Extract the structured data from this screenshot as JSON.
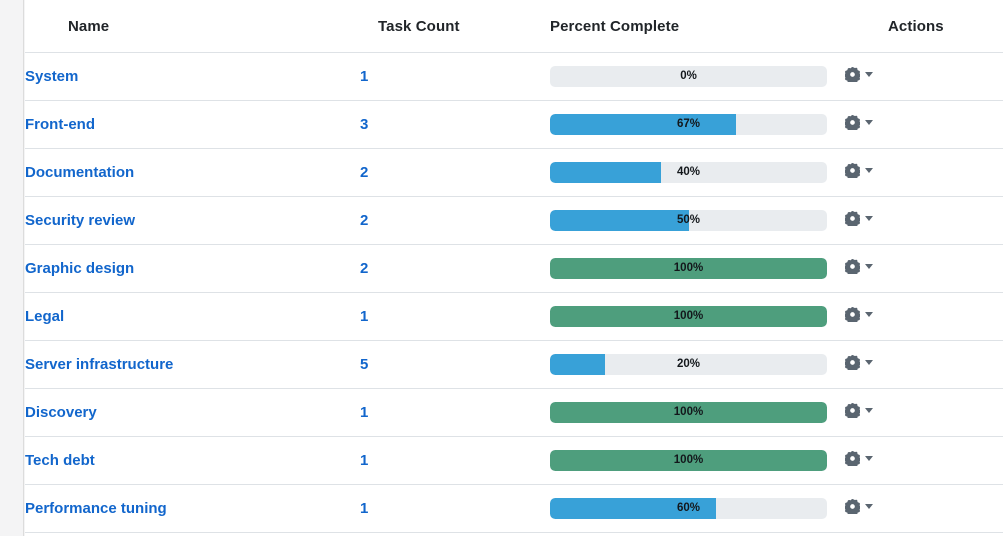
{
  "table": {
    "columns": [
      {
        "key": "name",
        "label": "Name"
      },
      {
        "key": "count",
        "label": "Task Count"
      },
      {
        "key": "percent",
        "label": "Percent Complete"
      },
      {
        "key": "actions",
        "label": "Actions"
      }
    ],
    "rows": [
      {
        "name": "System",
        "count": "1",
        "percent": 0,
        "percent_label": "0%",
        "actions_icon": "gear-icon"
      },
      {
        "name": "Front-end",
        "count": "3",
        "percent": 67,
        "percent_label": "67%",
        "actions_icon": "gear-icon"
      },
      {
        "name": "Documentation",
        "count": "2",
        "percent": 40,
        "percent_label": "40%",
        "actions_icon": "gear-icon"
      },
      {
        "name": "Security review",
        "count": "2",
        "percent": 50,
        "percent_label": "50%",
        "actions_icon": "gear-icon"
      },
      {
        "name": "Graphic design",
        "count": "2",
        "percent": 100,
        "percent_label": "100%",
        "actions_icon": "gear-icon"
      },
      {
        "name": "Legal",
        "count": "1",
        "percent": 100,
        "percent_label": "100%",
        "actions_icon": "gear-icon"
      },
      {
        "name": "Server infrastructure",
        "count": "5",
        "percent": 20,
        "percent_label": "20%",
        "actions_icon": "gear-icon"
      },
      {
        "name": "Discovery",
        "count": "1",
        "percent": 100,
        "percent_label": "100%",
        "actions_icon": "gear-icon"
      },
      {
        "name": "Tech debt",
        "count": "1",
        "percent": 100,
        "percent_label": "100%",
        "actions_icon": "gear-icon"
      },
      {
        "name": "Performance tuning",
        "count": "1",
        "percent": 60,
        "percent_label": "60%",
        "actions_icon": "gear-icon"
      }
    ]
  },
  "colors": {
    "link": "#1266cc",
    "progress_in_progress": "#38a1d8",
    "progress_complete": "#4e9e7d",
    "progress_track": "#e9ecef",
    "row_border": "#dee2e6",
    "header_text": "#212529",
    "gear": "#5a6570"
  }
}
